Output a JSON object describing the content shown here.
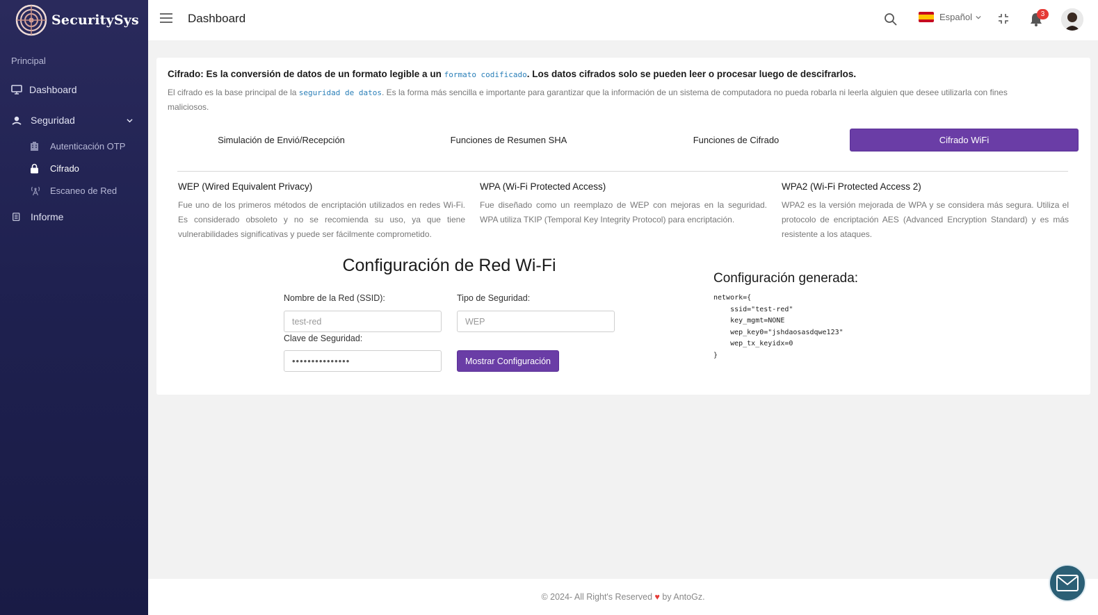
{
  "brand": {
    "name": "SecuritySys"
  },
  "sidebar": {
    "section": "Principal",
    "items": [
      {
        "label": "Dashboard",
        "icon": "monitor-icon"
      },
      {
        "label": "Seguridad",
        "icon": "shield-person-icon"
      },
      {
        "label": "Informe",
        "icon": "document-icon"
      }
    ],
    "sub_items": [
      {
        "label": "Autenticación OTP",
        "icon": "building-icon"
      },
      {
        "label": "Cifrado",
        "icon": "lock-icon"
      },
      {
        "label": "Escaneo de Red",
        "icon": "antenna-icon"
      }
    ]
  },
  "topbar": {
    "title": "Dashboard",
    "language": "Español",
    "notifications_count": "3"
  },
  "intro": {
    "title_before": "Cifrado: Es la conversión de datos de un formato legible a un ",
    "title_code": "formato codificado",
    "title_after": ". Los datos cifrados solo se pueden leer o procesar luego de descifrarlos.",
    "text_before": "El cifrado es la base principal de la ",
    "text_code": "seguridad de datos",
    "text_after": ". Es la forma más sencilla e importante para garantizar que la información de un sistema de computadora no pueda robarla ni leerla alguien que desee utilizarla con fines maliciosos."
  },
  "tabs": [
    {
      "label": "Simulación de Envió/Recepción"
    },
    {
      "label": "Funciones de Resumen SHA"
    },
    {
      "label": "Funciones de Cifrado"
    },
    {
      "label": "Cifrado WiFi"
    }
  ],
  "wifi_types": [
    {
      "title": "WEP (Wired Equivalent Privacy)",
      "text": "Fue uno de los primeros métodos de encriptación utilizados en redes Wi-Fi. Es considerado obsoleto y no se recomienda su uso, ya que tiene vulnerabilidades significativas y puede ser fácilmente comprometido."
    },
    {
      "title": "WPA (Wi-Fi Protected Access)",
      "text": "Fue diseñado como un reemplazo de WEP con mejoras en la seguridad. WPA utiliza TKIP (Temporal Key Integrity Protocol) para encriptación."
    },
    {
      "title": "WPA2 (Wi-Fi Protected Access 2)",
      "text": "WPA2 es la versión mejorada de WPA y se considera más segura. Utiliza el protocolo de encriptación AES (Advanced Encryption Standard) y es más resistente a los ataques."
    }
  ],
  "form": {
    "title": "Configuración de Red Wi-Fi",
    "ssid_label": "Nombre de la Red (SSID):",
    "ssid_value": "test-red",
    "security_label": "Tipo de Seguridad:",
    "security_value": "WEP",
    "key_label": "Clave de Seguridad:",
    "key_value": "•••••••••••••••",
    "button": "Mostrar Configuración"
  },
  "generated": {
    "title": "Configuración generada:",
    "code": "network={\n    ssid=\"test-red\"\n    key_mgmt=NONE\n    wep_key0=\"jshdaosasdqwe123\"\n    wep_tx_keyidx=0\n}"
  },
  "footer": {
    "text_before": "© 2024- All Right's Reserved ",
    "heart": "♥",
    "text_after": " by AntoGz."
  },
  "colors": {
    "accent": "#6a3da6",
    "sidebar": "#1f2150",
    "link_code": "#2a7fb8"
  }
}
